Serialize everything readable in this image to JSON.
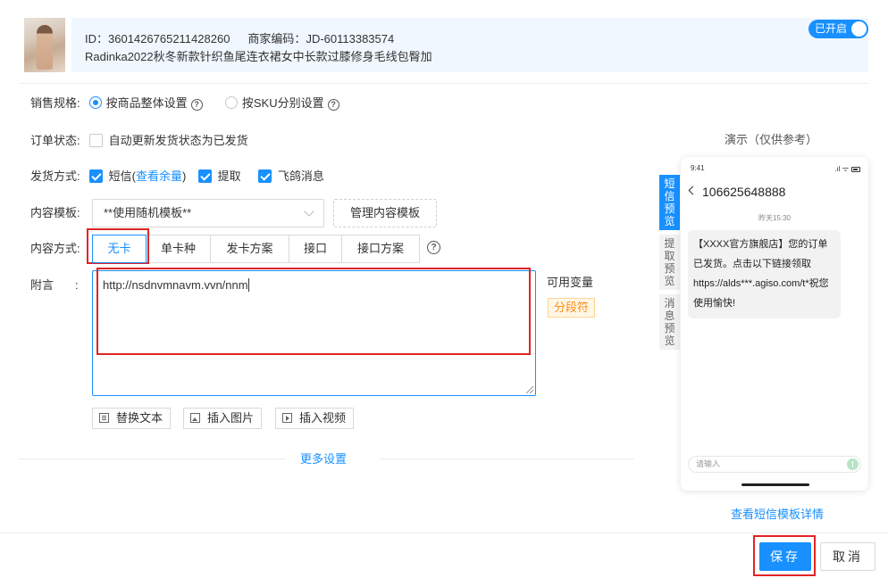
{
  "product": {
    "id_label": "ID：",
    "id_value": "3601426765211428260",
    "merchant_code_label": "商家编码：",
    "merchant_code_value": "JD-60113383574",
    "title": "Radinka2022秋冬新款针织鱼尾连衣裙女中长款过膝修身毛线包臀加",
    "toggle_label": "已开启",
    "toggle_on": true
  },
  "form": {
    "spec": {
      "label": "销售规格:",
      "options": [
        "按商品整体设置",
        "按SKU分别设置"
      ],
      "selected_index": 0
    },
    "order_status": {
      "label": "订单状态:",
      "checkbox_label": "自动更新发货状态为已发货",
      "checked": false
    },
    "delivery": {
      "label": "发货方式:",
      "sms": "短信",
      "sms_link": "查看余量",
      "sms_link_open": "(",
      "sms_link_close": ")",
      "pickup": "提取",
      "feige": "飞鸽消息"
    },
    "template": {
      "label": "内容模板:",
      "selected": "**使用随机模板**",
      "manage_button": "管理内容模板"
    },
    "content_mode": {
      "label": "内容方式:",
      "options": [
        "无卡",
        "单卡种",
        "发卡方案",
        "接口",
        "接口方案"
      ],
      "selected_index": 0
    },
    "note": {
      "label": "附言",
      "colon": ":",
      "value": "http://nsdnvmnavm.vvn/nnm",
      "available_vars_label": "可用变量",
      "var_tag": "分段符"
    },
    "tools": {
      "replace_text": "替换文本",
      "insert_image": "插入图片",
      "insert_video": "插入视频"
    },
    "more_settings": "更多设置"
  },
  "footer": {
    "save": "保存",
    "cancel": "取消"
  },
  "preview": {
    "title": "演示（仅供参考）",
    "tabs": [
      {
        "chars": [
          "短",
          "信",
          "预",
          "览"
        ],
        "active": true
      },
      {
        "chars": [
          "提",
          "取",
          "预",
          "览"
        ],
        "active": false
      },
      {
        "chars": [
          "消",
          "息",
          "预",
          "览"
        ],
        "active": false
      }
    ],
    "phone": {
      "time": "9:41",
      "signal": ".ıl ᯤ",
      "contact": "106625648888",
      "time_label": "昨天15:30",
      "message": "【XXXX官方旗舰店】您的订单已发货。点击以下链接领取https://alds***.agiso.com/t*祝您使用愉快!",
      "input_placeholder": "请输入"
    },
    "detail_link": "查看短信模板详情"
  },
  "colors": {
    "accent": "#1890ff",
    "highlight": "#e02424",
    "tag_orange": "#fa8c16"
  }
}
